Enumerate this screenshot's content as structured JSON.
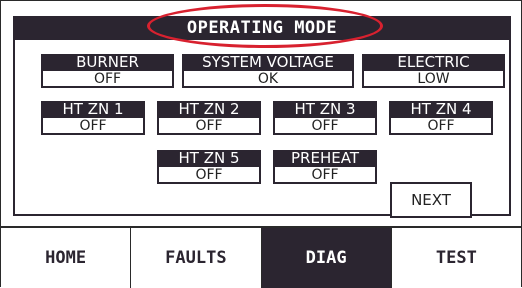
{
  "title": "OPERATING MODE",
  "colors": {
    "panel": "#2b2530",
    "highlight_ring": "#d8212f",
    "background": "#ffffff"
  },
  "status_tiles": [
    {
      "label": "BURNER",
      "value": "OFF"
    },
    {
      "label": "SYSTEM VOLTAGE",
      "value": "OK"
    },
    {
      "label": "ELECTRIC",
      "value": "LOW"
    },
    {
      "label": "HT ZN 1",
      "value": "OFF"
    },
    {
      "label": "HT ZN 2",
      "value": "OFF"
    },
    {
      "label": "HT ZN 3",
      "value": "OFF"
    },
    {
      "label": "HT ZN 4",
      "value": "OFF"
    },
    {
      "label": "HT ZN 5",
      "value": "OFF"
    },
    {
      "label": "PREHEAT",
      "value": "OFF"
    }
  ],
  "next_label": "NEXT",
  "tabs": [
    {
      "label": "HOME",
      "active": false
    },
    {
      "label": "FAULTS",
      "active": false
    },
    {
      "label": "DIAG",
      "active": true
    },
    {
      "label": "TEST",
      "active": false
    }
  ]
}
